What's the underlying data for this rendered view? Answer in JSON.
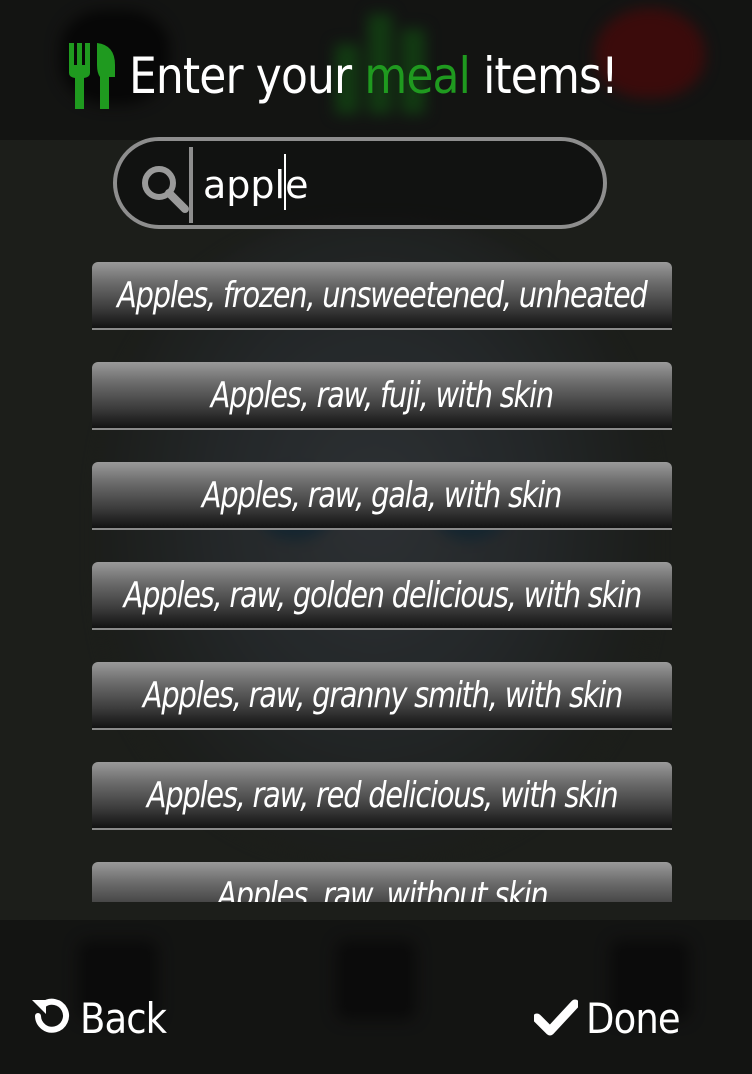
{
  "title": {
    "prefix": "Enter your",
    "accent": "meal",
    "suffix": "items!",
    "accent_color": "#1f9a1f",
    "icon": "fork-knife-icon"
  },
  "search": {
    "value": "apple",
    "placeholder": "",
    "icon": "search-icon"
  },
  "results": [
    "Apples, frozen, unsweetened, unheated",
    "Apples, raw, fuji, with skin",
    "Apples, raw, gala, with skin",
    "Apples, raw, golden delicious, with skin",
    "Apples, raw, granny smith, with skin",
    "Apples, raw, red delicious, with skin",
    "Apples, raw, without skin"
  ],
  "footer": {
    "back_label": "Back",
    "back_icon": "undo-icon",
    "done_label": "Done",
    "done_icon": "checkmark-icon"
  }
}
